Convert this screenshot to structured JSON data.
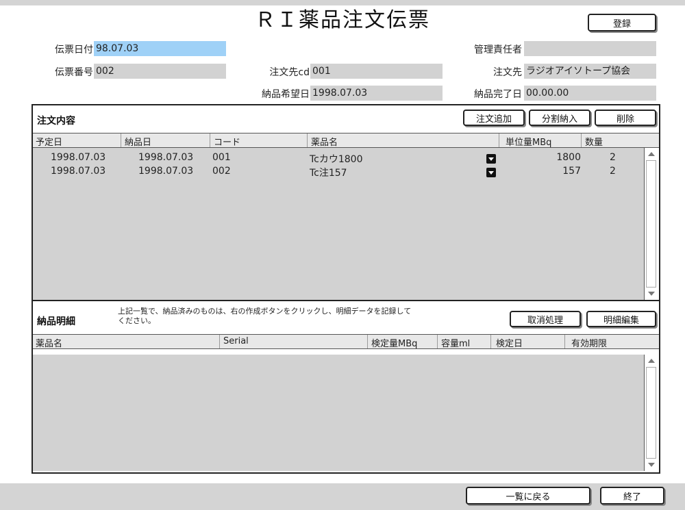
{
  "header": {
    "title": "ＲＩ薬品注文伝票",
    "register_label": "登録"
  },
  "fields": {
    "slip_date": {
      "label": "伝票日付",
      "value": "98.07.03"
    },
    "slip_number": {
      "label": "伝票番号",
      "value": "002"
    },
    "manager": {
      "label": "管理責任者",
      "value": ""
    },
    "supplier_cd": {
      "label": "注文先cd",
      "value": "001"
    },
    "supplier": {
      "label": "注文先",
      "value": "ラジオアイソトープ協会"
    },
    "desired_date": {
      "label": "納品希望日",
      "value": "1998.07.03"
    },
    "complete_date": {
      "label": "納品完了日",
      "value": "00.00.00"
    }
  },
  "order_section": {
    "title": "注文内容",
    "buttons": {
      "add": "注文追加",
      "split": "分割納入",
      "delete": "削除"
    },
    "columns": [
      "予定日",
      "納品日",
      "コード",
      "薬品名",
      "単位量MBq",
      "数量"
    ],
    "rows": [
      {
        "scheduled": "1998.07.03",
        "delivered": "1998.07.03",
        "code": "001",
        "name": "Tcカウ1800",
        "unit": "1800",
        "qty": "2"
      },
      {
        "scheduled": "1998.07.03",
        "delivered": "1998.07.03",
        "code": "002",
        "name": "Tc注157",
        "unit": "157",
        "qty": "2"
      }
    ]
  },
  "delivery_section": {
    "title": "納品明細",
    "note_line1": "上記一覧で、納品済みのものは、右の作成ボタンをクリックし、明細データを記録して",
    "note_line2": "ください。",
    "buttons": {
      "cancel": "取消処理",
      "edit": "明細編集"
    },
    "columns": [
      "薬品名",
      "Serial",
      "検定量MBq",
      "容量ml",
      "検定日",
      "有効期限"
    ]
  },
  "footer": {
    "back_label": "一覧に戻る",
    "exit_label": "終了"
  }
}
